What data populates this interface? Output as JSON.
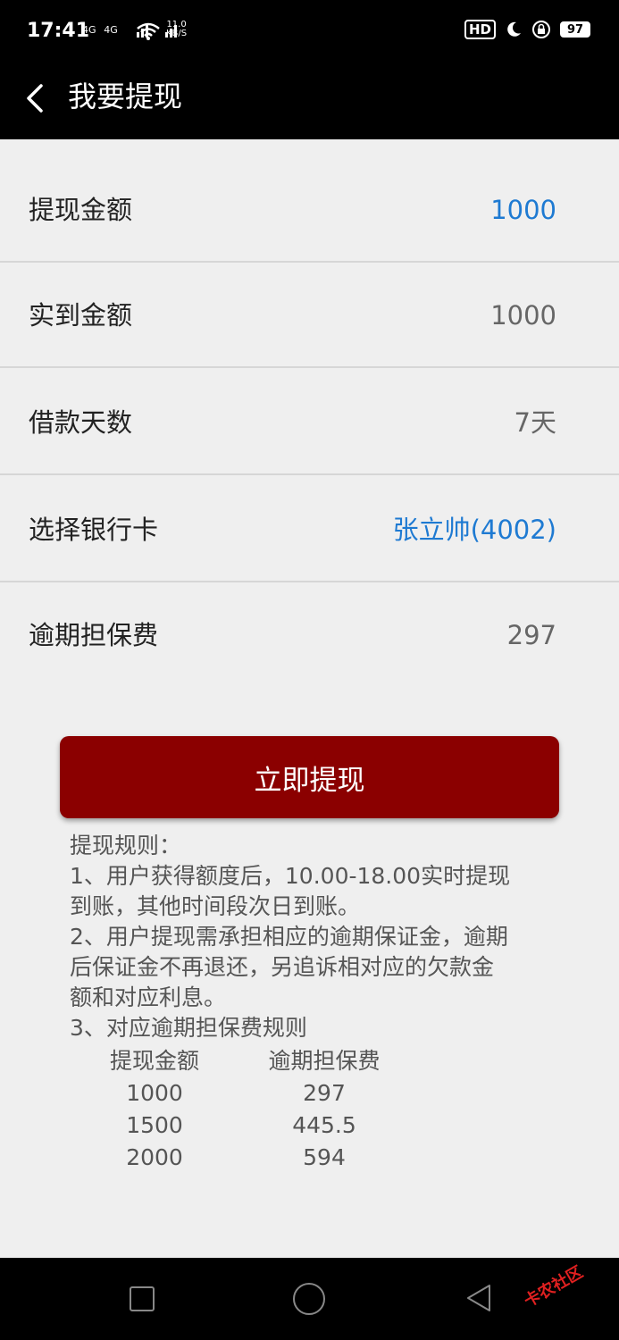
{
  "status_bar": {
    "time": "17:41",
    "network": "4G    4G",
    "speed_value": "11.0",
    "speed_unit": "KB/S",
    "hd_label": "HD",
    "battery": "97"
  },
  "header": {
    "title": "我要提现"
  },
  "form": {
    "rows": [
      {
        "label": "提现金额",
        "value": "1000"
      },
      {
        "label": "实到金额",
        "value": "1000"
      },
      {
        "label": "借款天数",
        "value": "7天"
      },
      {
        "label": "选择银行卡",
        "value": "张立帅(4002)"
      },
      {
        "label": "逾期担保费",
        "value": "297"
      }
    ]
  },
  "button": {
    "label": "立即提现"
  },
  "rules": {
    "title": "提现规则：",
    "lines": [
      "1、用户获得额度后，10.00-18.00实时提现",
      "到账，其他时间段次日到账。",
      "2、用户提现需承担相应的逾期保证金，逾期",
      "后保证金不再退还，另追诉相对应的欠款金",
      "额和对应利息。",
      "3、对应逾期担保费规则"
    ],
    "table": {
      "headers": [
        "提现金额",
        "逾期担保费"
      ],
      "rows": [
        [
          "1000",
          "297"
        ],
        [
          "1500",
          "445.5"
        ],
        [
          "2000",
          "594"
        ]
      ]
    }
  },
  "watermark": "卡农社区",
  "colors": {
    "accent_blue": "#1e7ad2",
    "button_red": "#8b0000"
  }
}
